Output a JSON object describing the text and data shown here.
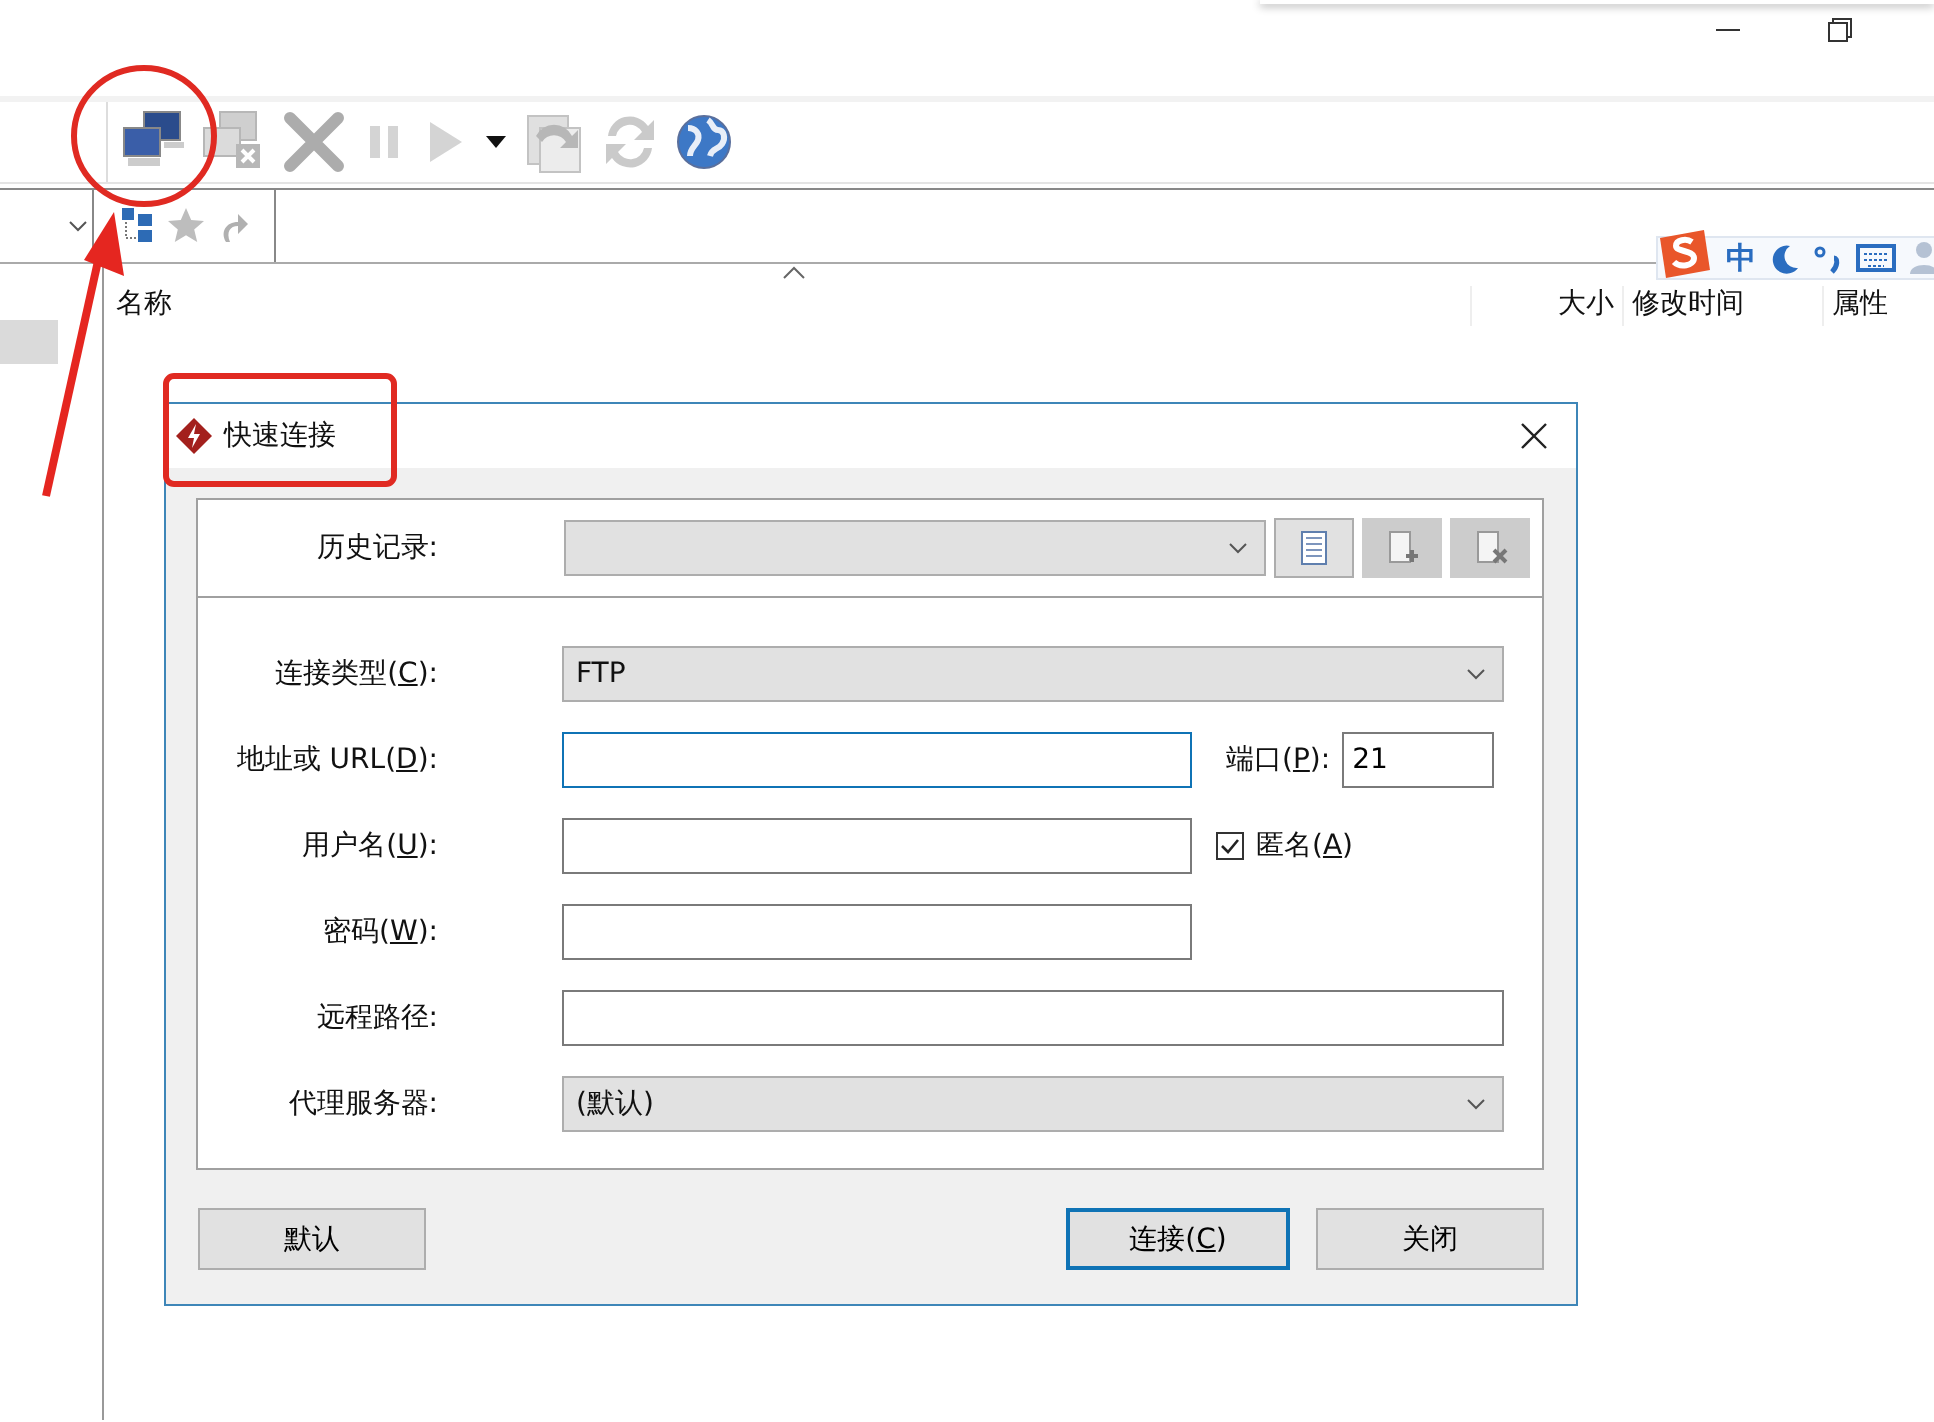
{
  "toolbar": [
    {
      "kind": "connect",
      "disabled": false
    },
    {
      "kind": "disconnect",
      "disabled": true
    },
    {
      "kind": "cancel",
      "disabled": true
    },
    {
      "kind": "pause",
      "disabled": true
    },
    {
      "kind": "play",
      "disabled": true
    },
    {
      "kind": "menu-caret",
      "disabled": false
    },
    {
      "kind": "transfer",
      "disabled": true
    },
    {
      "kind": "refresh",
      "disabled": true
    },
    {
      "kind": "globe",
      "disabled": false
    }
  ],
  "address_bar": {
    "icons": [
      {
        "kind": "tree"
      },
      {
        "kind": "star"
      },
      {
        "kind": "up"
      }
    ]
  },
  "left_tree": {
    "rows": [
      {
        "selected": true
      }
    ]
  },
  "file_list": {
    "columns": [
      "名称",
      "大小",
      "修改时间",
      "属性"
    ]
  },
  "ime_bar": {
    "mode": "中"
  },
  "dialog": {
    "title": "快速连接",
    "history": {
      "label": "历史记录:",
      "buttons": [
        {
          "kind": "list",
          "disabled": false
        },
        {
          "kind": "add",
          "disabled": true
        },
        {
          "kind": "delete",
          "disabled": true
        }
      ]
    },
    "rows": [
      {
        "kind": "select",
        "label": [
          "连接类型(",
          "C",
          "):"
        ],
        "value": "FTP",
        "wide": true
      },
      {
        "kind": "input",
        "label": [
          "地址或 URL(",
          "D",
          "):"
        ],
        "value": "",
        "focused": true,
        "extra": {
          "kind": "port",
          "label": [
            "端口(",
            "P",
            "):"
          ],
          "value": "21"
        }
      },
      {
        "kind": "input",
        "label": [
          "用户名(",
          "U",
          "):"
        ],
        "value": "",
        "focused": false,
        "extra": {
          "kind": "checkbox",
          "label": [
            "匿名(",
            "A",
            ")"
          ],
          "checked": true
        }
      },
      {
        "kind": "input",
        "label": [
          "密码(",
          "W",
          "):"
        ],
        "value": "",
        "focused": false
      },
      {
        "kind": "input",
        "label": [
          "远程路径:"
        ],
        "value": "",
        "focused": false,
        "wide": true
      },
      {
        "kind": "select",
        "label": [
          "代理服务器:"
        ],
        "value": "(默认)",
        "wide": true
      }
    ],
    "buttons": [
      {
        "label": [
          "默认"
        ],
        "default": false
      },
      {
        "label": [
          "连接(",
          "C",
          ")"
        ],
        "default": true
      },
      {
        "label": [
          "关闭"
        ],
        "default": false
      }
    ]
  },
  "annotations": [
    {
      "kind": "circle"
    },
    {
      "kind": "arrow"
    },
    {
      "kind": "rect"
    }
  ]
}
